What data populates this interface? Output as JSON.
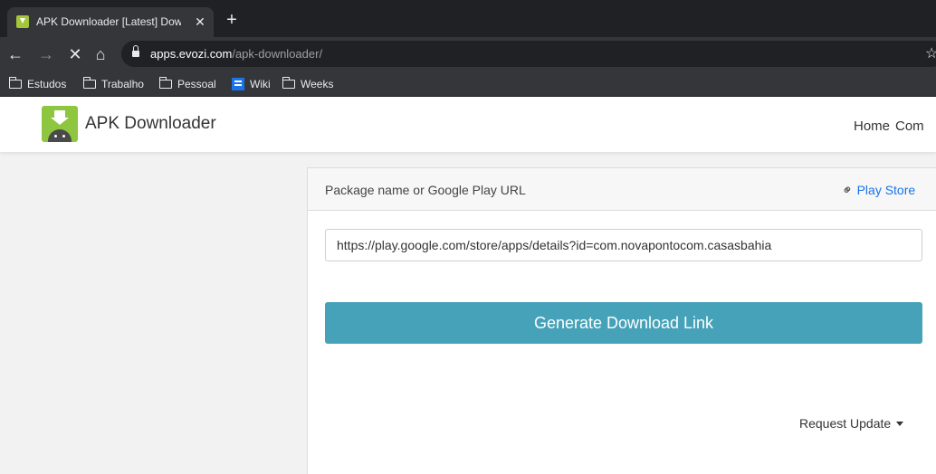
{
  "browser": {
    "tab": {
      "title": "APK Downloader [Latest] Downl",
      "favicon": "apk-downloader-favicon"
    },
    "url": {
      "host": "apps.evozi.com",
      "path": "/apk-downloader/"
    },
    "bookmarks": [
      {
        "label": "Estudos",
        "icon": "folder-icon"
      },
      {
        "label": "Trabalho",
        "icon": "folder-icon"
      },
      {
        "label": "Pessoal",
        "icon": "folder-icon"
      },
      {
        "label": "Wiki",
        "icon": "wiki-icon"
      },
      {
        "label": "Weeks",
        "icon": "folder-icon"
      }
    ]
  },
  "navbar": {
    "brand": "APK Downloader",
    "links": [
      "Home",
      "Com"
    ]
  },
  "form": {
    "header_label": "Package name or Google Play URL",
    "playstore_link": "Play Store",
    "input_value": "https://play.google.com/store/apps/details?id=com.novapontocom.casasbahia",
    "generate_label": "Generate Download Link",
    "request_update": "Request Update"
  },
  "colors": {
    "accent_button": "#45a2b9",
    "link": "#1a73e8",
    "logo_green": "#8ec63f"
  }
}
